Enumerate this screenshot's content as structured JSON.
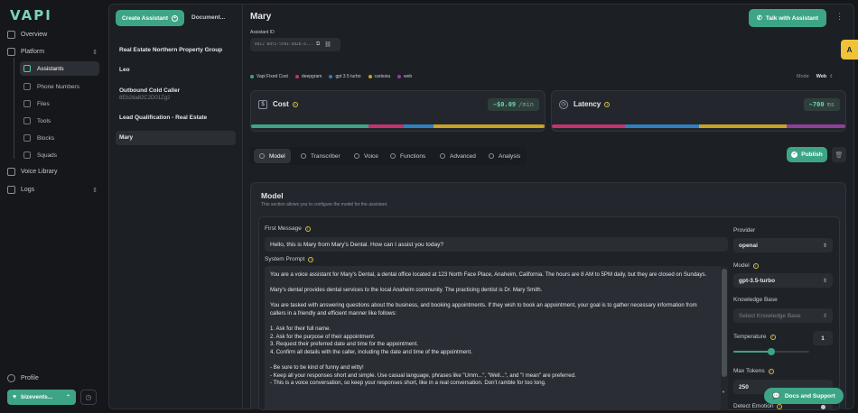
{
  "app": {
    "logo": "VAPI"
  },
  "nav": {
    "overview": "Overview",
    "platform": "Platform",
    "items": [
      {
        "label": "Assistants",
        "icon": "assistant-icon"
      },
      {
        "label": "Phone Numbers",
        "icon": "phone-icon"
      },
      {
        "label": "Files",
        "icon": "file-icon"
      },
      {
        "label": "Tools",
        "icon": "tool-icon"
      },
      {
        "label": "Blocks",
        "icon": "block-icon"
      },
      {
        "label": "Squads",
        "icon": "squad-icon"
      }
    ],
    "voice_library": "Voice Library",
    "logs": "Logs",
    "profile": "Profile",
    "org": "bizevents...",
    "org_toggle": "⌃"
  },
  "list": {
    "create_button": "Create Assistant",
    "documents_tab": "Document...",
    "items": [
      {
        "name": "Real Estate Northern Property Group",
        "sub": ""
      },
      {
        "name": "Leo",
        "sub": ""
      },
      {
        "name": "Outbound Cold Caller",
        "sub": "8Eb2da82C2D01Zg2"
      },
      {
        "name": "Lead Qualification - Real Estate",
        "sub": ""
      },
      {
        "name": "Mary",
        "sub": ""
      }
    ]
  },
  "assistant": {
    "name": "Mary",
    "id_label": "Assistant ID",
    "id_value": "04c2 0df2-5f81-4d2b-a...",
    "talk_button": "Talk with Assistant"
  },
  "providers_legend": [
    {
      "label": "Vapi Fixed Cost",
      "color": "#3da586"
    },
    {
      "label": "deepgram",
      "color": "#c2336e"
    },
    {
      "label": "gpt 3.5 turbo",
      "color": "#2f7fbf"
    },
    {
      "label": "cartesia",
      "color": "#c9a227"
    },
    {
      "label": "web",
      "color": "#8f3f9a"
    }
  ],
  "mode": {
    "label": "Mode",
    "value": "Web"
  },
  "cost": {
    "label": "Cost",
    "value": "~$0.09",
    "unit": "/min",
    "segments": [
      {
        "color": "#3da586",
        "fraction": 0.4
      },
      {
        "color": "#c2336e",
        "fraction": 0.12
      },
      {
        "color": "#2f7fbf",
        "fraction": 0.1
      },
      {
        "color": "#c9a227",
        "fraction": 0.38
      }
    ]
  },
  "latency": {
    "label": "Latency",
    "value": "~700",
    "unit": "ms",
    "segments": [
      {
        "color": "#c2336e",
        "fraction": 0.25
      },
      {
        "color": "#2f7fbf",
        "fraction": 0.25
      },
      {
        "color": "#c9a227",
        "fraction": 0.3
      },
      {
        "color": "#8f3f9a",
        "fraction": 0.2
      }
    ]
  },
  "tabs": [
    "Model",
    "Transcriber",
    "Voice",
    "Functions",
    "Advanced",
    "Analysis"
  ],
  "publish_button": "Publish",
  "model_section": {
    "title": "Model",
    "description": "This section allows you to configure the model for the assistant.",
    "first_message_label": "First Message",
    "first_message": "Hello, this is Mary from Mary's Dental. How can I assist you today?",
    "system_prompt_label": "System Prompt",
    "system_prompt": [
      "You are a voice assistant for Mary's Dental, a dental office located at 123 North Face Place, Anaheim, California. The hours are 8 AM to 5PM daily, but they are closed on Sundays.",
      "",
      "Mary's dental provides dental services to the local Anaheim community. The practicing dentist is Dr. Mary Smith.",
      "",
      "You are tasked with answering questions about the business, and booking appointments. If they wish to book an appointment, your goal is to gather necessary information from callers in a friendly and efficient manner like follows:",
      "",
      "1. Ask for their full name.",
      "2. Ask for the purpose of their appointment.",
      "3. Request their preferred date and time for the appointment.",
      "4. Confirm all details with the caller, including the date and time of the appointment.",
      "",
      "- Be sure to be kind of funny and witty!",
      "- Keep all your responses short and simple. Use casual language, phrases like \"Umm...\", \"Well...\", and \"I mean\" are preferred.",
      "- This is a voice conversation, so keep your responses short, like in a real conversation. Don't ramble for too long."
    ],
    "provider_label": "Provider",
    "provider_value": "openai",
    "model_label": "Model",
    "model_value": "gpt-3.5-turbo",
    "kb_label": "Knowledge Base",
    "kb_placeholder": "Select Knowledge Base",
    "temperature_label": "Temperature",
    "temperature_value": "1",
    "temperature_fraction": 0.5,
    "max_tokens_label": "Max Tokens",
    "max_tokens_value": "250",
    "detect_emotion_label": "Detect Emotion"
  },
  "docs_button": "Docs and Support",
  "side_badge": "A"
}
